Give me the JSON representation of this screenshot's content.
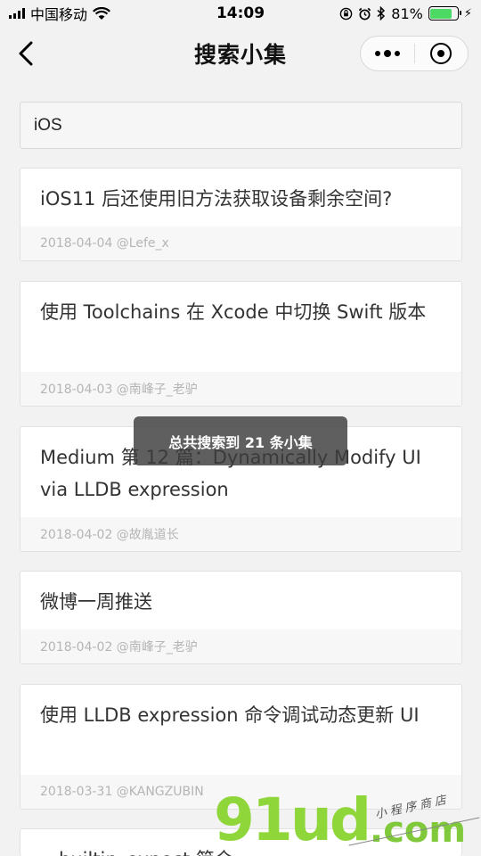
{
  "status_bar": {
    "carrier": "中国移动",
    "time": "14:09",
    "battery_percent": "81%",
    "battery_level": 0.81
  },
  "nav": {
    "title": "搜索小集"
  },
  "search": {
    "value": "iOS"
  },
  "results": [
    {
      "title": "iOS11 后还使用旧方法获取设备剩余空间?",
      "meta": "2018-04-04 @Lefe_x"
    },
    {
      "title": "使用 Toolchains 在 Xcode 中切换 Swift 版本",
      "meta": "2018-04-03 @南峰子_老驴"
    },
    {
      "title": "Medium 第 12 篇：Dynamically Modify UI via LLDB expression",
      "meta": "2018-04-02 @故胤道长"
    },
    {
      "title": "微博一周推送",
      "meta": "2018-04-02 @南峰子_老驴"
    },
    {
      "title": "使用 LLDB expression 命令调试动态更新 UI",
      "meta": "2018-03-31 @KANGZUBIN"
    },
    {
      "title": "__builtin_expect 简介",
      "meta": ""
    }
  ],
  "toast": {
    "text": "总共搜索到 21 条小集"
  },
  "watermark": {
    "main": "91ud",
    "domain": ".com",
    "sub": "小程序商店"
  },
  "colors": {
    "background": "#f2f2f2",
    "battery_green": "#4cd964",
    "watermark_green": "#8fd63a"
  }
}
